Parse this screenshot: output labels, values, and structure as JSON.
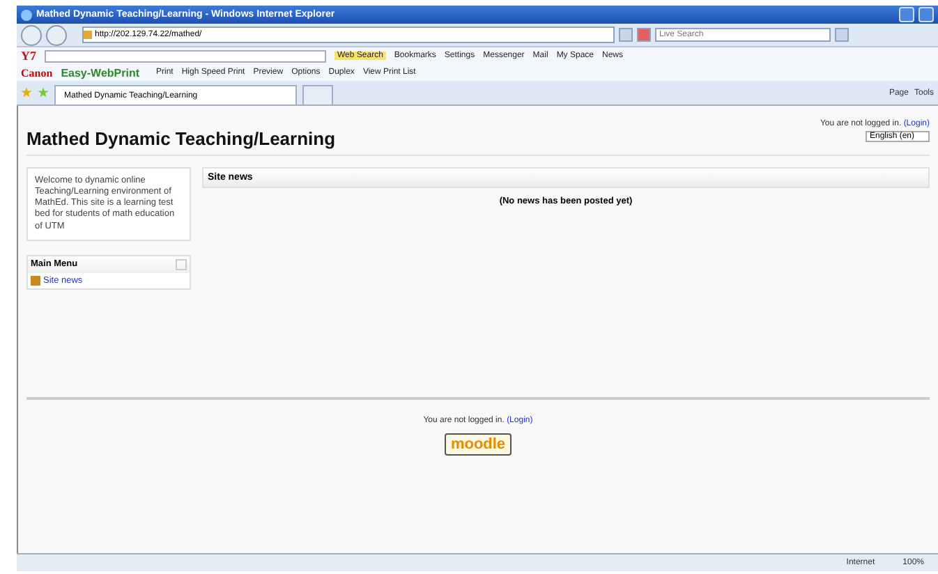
{
  "window": {
    "title": "Mathed Dynamic Teaching/Learning - Windows Internet Explorer"
  },
  "address_bar": {
    "url": "http://202.129.74.22/mathed/",
    "search_placeholder": "Live Search"
  },
  "yahoo_toolbar": {
    "logo": "Y7",
    "items": [
      {
        "label": "Web Search",
        "highlighted": true
      },
      {
        "label": "Bookmarks",
        "highlighted": false
      },
      {
        "label": "Settings",
        "highlighted": false
      },
      {
        "label": "Messenger",
        "highlighted": false
      },
      {
        "label": "Mail",
        "highlighted": false
      },
      {
        "label": "My Space",
        "highlighted": false
      },
      {
        "label": "News",
        "highlighted": false
      }
    ]
  },
  "print_toolbar": {
    "brand": "Canon",
    "product": "Easy-WebPrint",
    "items": [
      "Print",
      "High Speed Print",
      "Preview",
      "Options",
      "Duplex",
      "View Print List"
    ]
  },
  "tabs": [
    {
      "label": "Mathed Dynamic Teaching/Learning",
      "selected": true
    }
  ],
  "command_bar": [
    "Page",
    "Tools"
  ],
  "page": {
    "heading": "Mathed Dynamic Teaching/Learning",
    "login_info": {
      "text": "You are not logged in.",
      "link": "(Login)"
    },
    "language": "English (en)",
    "welcome": "Welcome to dynamic online Teaching/Learning environment of MathEd. This site is a learning test bed for students of math education of UTM",
    "main_menu": {
      "title": "Main Menu",
      "items": [
        "Site news"
      ]
    },
    "site_news": {
      "title": "Site news",
      "message": "(No news has been posted yet)"
    },
    "footer": {
      "text": "You are not logged in.",
      "link": "(Login)",
      "logo": "moodle"
    }
  },
  "status_bar": {
    "zone": "Internet",
    "zoom": "100%"
  }
}
